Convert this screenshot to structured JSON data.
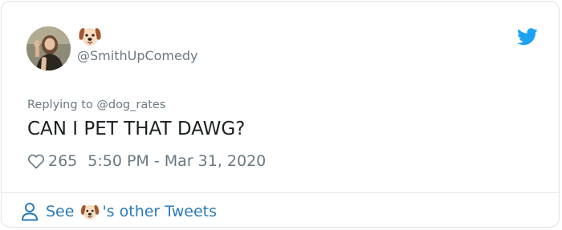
{
  "tweet": {
    "author": {
      "display_name_icon": "dog-face-emoji",
      "handle": "@SmithUpComedy",
      "avatar": "profile-photo"
    },
    "platform_icon": "twitter-bird-icon",
    "reply_prefix": "Replying to",
    "reply_to": "@dog_rates",
    "text": "CAN I PET THAT DAWG?",
    "likes": "265",
    "timestamp": "5:50 PM - Mar 31, 2020"
  },
  "footer": {
    "see_label": "See",
    "author_icon": "dog-face-emoji",
    "suffix_label": "'s other Tweets"
  },
  "colors": {
    "text": "#1c2022",
    "muted": "#697882",
    "link": "#2b7bb9",
    "twitter_blue": "#1da1f2",
    "border": "#dfe3e6"
  }
}
